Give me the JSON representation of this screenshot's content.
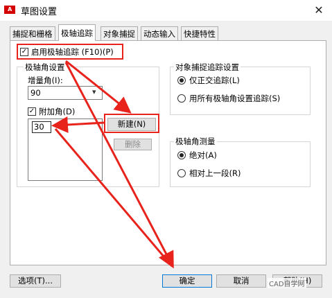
{
  "window": {
    "title": "草图设置",
    "app_icon_text": "A",
    "close_glyph": "✕"
  },
  "tabs": [
    {
      "label": "捕捉和栅格",
      "active": false
    },
    {
      "label": "极轴追踪",
      "active": true
    },
    {
      "label": "对象捕捉",
      "active": false
    },
    {
      "label": "动态输入",
      "active": false
    },
    {
      "label": "快捷特性",
      "active": false
    }
  ],
  "polar": {
    "enable_label": "启用极轴追踪 (F10)(P)",
    "enable_checked": true,
    "angle_group_title": "极轴角设置",
    "increment_label": "增量角(I):",
    "increment_value": "90",
    "additional_label": "附加角(D)",
    "additional_checked": true,
    "additional_values": [
      "30"
    ],
    "new_button": "新建(N)",
    "delete_button": "删除"
  },
  "snap_tracking": {
    "title": "对象捕捉追踪设置",
    "options": [
      {
        "label": "仅正交追踪(L)",
        "selected": true
      },
      {
        "label": "用所有极轴角设置追踪(S)",
        "selected": false
      }
    ]
  },
  "measurement": {
    "title": "极轴角测量",
    "options": [
      {
        "label": "绝对(A)",
        "selected": true
      },
      {
        "label": "相对上一段(R)",
        "selected": false
      }
    ]
  },
  "footer": {
    "options_button": "选项(T)...",
    "ok_button": "确定",
    "cancel_button": "取消",
    "help_button": "帮助(H)"
  },
  "watermark": "CAD自学网",
  "colors": {
    "highlight_red": "#e8231c",
    "focus_blue": "#0078d7"
  }
}
